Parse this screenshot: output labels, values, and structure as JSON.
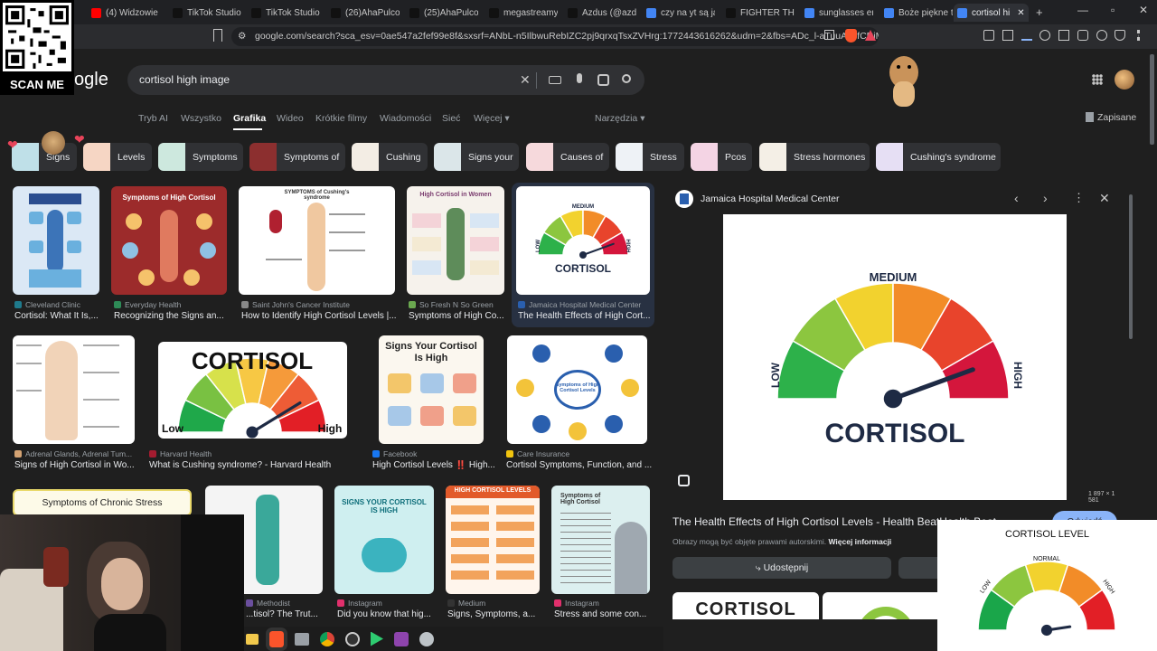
{
  "qr": {
    "label": "SCAN ME"
  },
  "tabs": [
    {
      "label": "(4) Widzowie na",
      "color": "#ff0000"
    },
    {
      "label": "TikTok Studio",
      "color": "#111111"
    },
    {
      "label": "TikTok Studio",
      "color": "#111111"
    },
    {
      "label": "(26)AhaPulco (i",
      "color": "#111111"
    },
    {
      "label": "(25)AhaPulco (i",
      "color": "#111111"
    },
    {
      "label": "megastreamy c",
      "color": "#111111"
    },
    {
      "label": "Azdus (@azdus",
      "color": "#111111"
    },
    {
      "label": "czy na yt są jaki",
      "color": "#4285f4"
    },
    {
      "label": "FIGHTER THRO",
      "color": "#111111"
    },
    {
      "label": "sunglasses em",
      "color": "#4285f4"
    },
    {
      "label": "Boże piękne to",
      "color": "#4285f4"
    },
    {
      "label": "cortisol hi",
      "color": "#4285f4"
    }
  ],
  "address": {
    "url": "google.com/search?sca_esv=0ae547a2fef99e8f&sxsrf=ANbL-n5IlbwuRebIZC2pj9qrxqTsxZVHrg:1772443616262&udm=2&fbs=ADc_l-aTuuAJ5fCRiMS..."
  },
  "search": {
    "logo": "ogle",
    "query": "cortisol high image"
  },
  "nav": {
    "items": [
      "Tryb AI",
      "Wszystko",
      "Grafika",
      "Wideo",
      "Krótkie filmy",
      "Wiadomości",
      "Sieć",
      "Więcej ▾"
    ],
    "tools": "Narzędzia ▾",
    "saved": "Zapisane"
  },
  "chips": [
    "Signs",
    "Levels",
    "Symptoms",
    "Symptoms of",
    "Cushing",
    "Signs your",
    "Causes of",
    "Stress",
    "Pcos",
    "Stress hormones",
    "Cushing's syndrome"
  ],
  "results": [
    {
      "source": "Cleveland Clinic",
      "title": "Cortisol: What It Is,..."
    },
    {
      "source": "Everyday Health",
      "title": "Recognizing the Signs an..."
    },
    {
      "source": "Saint John's Cancer Institute",
      "title": "How to Identify High Cortisol Levels |..."
    },
    {
      "source": "So Fresh N So Green",
      "title": "Symptoms of High Co..."
    },
    {
      "source": "Jamaica Hospital Medical Center",
      "title": "The Health Effects of High Cort..."
    },
    {
      "source": "Adrenal Glands, Adrenal Tum...",
      "title": "Signs of High Cortisol in Wo..."
    },
    {
      "source": "Harvard Health",
      "title": "What is Cushing syndrome? - Harvard Health"
    },
    {
      "source": "Facebook",
      "title": "High Cortisol Levels ‼️ High..."
    },
    {
      "source": "Care Insurance",
      "title": "Cortisol Symptoms, Function, and ..."
    },
    {
      "source": "Methodist",
      "title": "...tisol? The Trut..."
    },
    {
      "source": "Instagram",
      "title": "Did you know that hig..."
    },
    {
      "source": "Medium",
      "title": "Signs, Symptoms, a..."
    },
    {
      "source": "Instagram",
      "title": "Stress and some con..."
    }
  ],
  "thumbs": {
    "t1": "Symptoms of High Cortisol",
    "t2": "SYMPTOMS of Cushing's syndrome",
    "t3": "High Cortisol in Women",
    "t4": "CORTISOL",
    "t5": "CORTISOL",
    "t6": "Signs Your Cortisol Is High",
    "t7": "Symptoms of High Cortisol Levels",
    "t8": "Symptoms of Chronic Stress",
    "t9": "SIGNS YOUR CORTISOL IS HIGH",
    "t10": "HIGH CORTISOL LEVELS",
    "t11": "Symptoms of High Cortisol",
    "low": "Low",
    "high": "High"
  },
  "panel": {
    "source": "Jamaica Hospital Medical Center",
    "gauge": {
      "medium": "MEDIUM",
      "low": "LOW",
      "high": "HIGH",
      "title": "CORTISOL"
    },
    "size": "1 897 × 1 581",
    "title": "The Health Effects of High Cortisol Levels - Health BeatHealth Beat",
    "copyright": "Obrazy mogą być objęte prawami autorskimi.",
    "more_info": "Więcej informacji",
    "share": "Udostępnij",
    "visit": "Odwiedź"
  },
  "overlay": {
    "title": "CORTISOL LEVEL",
    "normal": "NORMAL",
    "low": "LOW",
    "high": "HIGH"
  },
  "gauge_colors": [
    "#2db14a",
    "#8cc63f",
    "#f2d22e",
    "#f28c28",
    "#e8442c",
    "#d4163c"
  ]
}
